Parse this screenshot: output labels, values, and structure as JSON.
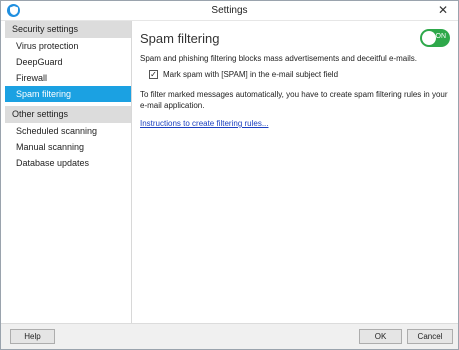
{
  "window": {
    "title": "Settings"
  },
  "sidebar": {
    "sections": [
      {
        "header": "Security settings",
        "items": [
          {
            "label": "Virus protection",
            "selected": false
          },
          {
            "label": "DeepGuard",
            "selected": false
          },
          {
            "label": "Firewall",
            "selected": false
          },
          {
            "label": "Spam filtering",
            "selected": true
          }
        ]
      },
      {
        "header": "Other settings",
        "items": [
          {
            "label": "Scheduled scanning",
            "selected": false
          },
          {
            "label": "Manual scanning",
            "selected": false
          },
          {
            "label": "Database updates",
            "selected": false
          }
        ]
      }
    ]
  },
  "main": {
    "title": "Spam filtering",
    "toggle_label": "ON",
    "toggle_on": true,
    "description": "Spam and phishing filtering blocks mass advertisements and deceitful e-mails.",
    "checkbox_label": "Mark spam with [SPAM] in the e-mail subject field",
    "checkbox_checked": true,
    "checkbox_mark": "✓",
    "info": "To filter marked messages automatically, you have to create spam filtering rules in your e-mail application.",
    "link": "Instructions to create filtering rules..."
  },
  "footer": {
    "help": "Help",
    "ok": "OK",
    "cancel": "Cancel"
  },
  "icons": {
    "app": "shield-icon",
    "close": "close-icon"
  },
  "colors": {
    "accent": "#1ba1e2",
    "toggle": "#2ea84a",
    "link": "#1a3fbf"
  }
}
